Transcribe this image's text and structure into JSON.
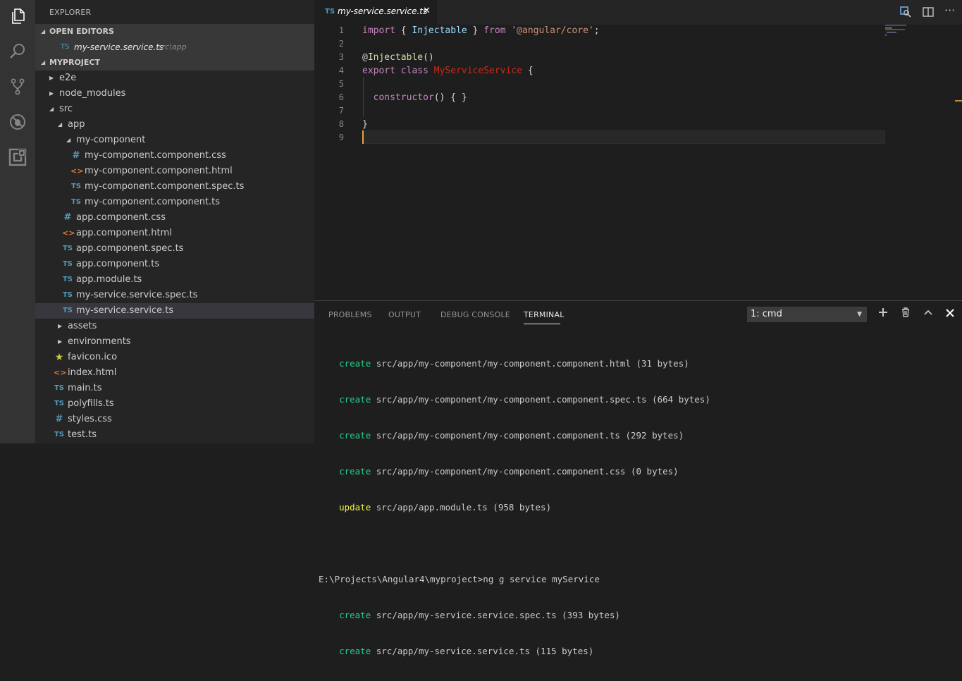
{
  "activity_bar": {
    "icons": [
      "files-icon",
      "search-icon",
      "source-control-icon",
      "debug-icon",
      "extensions-icon"
    ]
  },
  "sidebar": {
    "title": "EXPLORER",
    "open_editors": {
      "label": "OPEN EDITORS",
      "items": [
        {
          "icon": "TS",
          "name": "my-service.service.ts",
          "path": "src\\app"
        }
      ]
    },
    "project": {
      "label": "MYPROJECT",
      "tree": [
        {
          "name": "e2e",
          "type": "folder",
          "expanded": false
        },
        {
          "name": "node_modules",
          "type": "folder",
          "expanded": false
        },
        {
          "name": "src",
          "type": "folder",
          "expanded": true
        },
        {
          "name": "app",
          "type": "folder",
          "expanded": true
        },
        {
          "name": "my-component",
          "type": "folder",
          "expanded": true
        },
        {
          "name": "my-component.component.css",
          "type": "css"
        },
        {
          "name": "my-component.component.html",
          "type": "html"
        },
        {
          "name": "my-component.component.spec.ts",
          "type": "ts"
        },
        {
          "name": "my-component.component.ts",
          "type": "ts"
        },
        {
          "name": "app.component.css",
          "type": "css"
        },
        {
          "name": "app.component.html",
          "type": "html"
        },
        {
          "name": "app.component.spec.ts",
          "type": "ts"
        },
        {
          "name": "app.component.ts",
          "type": "ts"
        },
        {
          "name": "app.module.ts",
          "type": "ts"
        },
        {
          "name": "my-service.service.spec.ts",
          "type": "ts"
        },
        {
          "name": "my-service.service.ts",
          "type": "ts",
          "selected": true
        },
        {
          "name": "assets",
          "type": "folder",
          "expanded": false
        },
        {
          "name": "environments",
          "type": "folder",
          "expanded": false
        },
        {
          "name": "favicon.ico",
          "type": "ico"
        },
        {
          "name": "index.html",
          "type": "html"
        },
        {
          "name": "main.ts",
          "type": "ts"
        },
        {
          "name": "polyfills.ts",
          "type": "ts"
        },
        {
          "name": "styles.css",
          "type": "css"
        },
        {
          "name": "test.ts",
          "type": "ts"
        }
      ]
    }
  },
  "editor": {
    "tab": {
      "icon": "TS",
      "name": "my-service.service.ts",
      "close": "✕"
    },
    "line_numbers": [
      "1",
      "2",
      "3",
      "4",
      "5",
      "6",
      "7",
      "8",
      "9"
    ],
    "code": {
      "l1_import": "import",
      "l1_open": " { ",
      "l1_ident": "Injectable",
      "l1_close": " } ",
      "l1_from": "from",
      "l1_sp": " ",
      "l1_str": "'@angular/core'",
      "l1_semi": ";",
      "l3_at": "@",
      "l3_deco": "Injectable",
      "l3_parens": "()",
      "l4_export": "export",
      "l4_class": "class",
      "l4_name": "MyServiceService",
      "l4_brace": " {",
      "l6_ctor": "constructor",
      "l6_rest": "() { }",
      "l8_close": "}"
    }
  },
  "panel": {
    "tabs": [
      "PROBLEMS",
      "OUTPUT",
      "DEBUG CONSOLE",
      "TERMINAL"
    ],
    "active_tab": "TERMINAL",
    "terminal_select": "1: cmd",
    "terminal_lines": [
      {
        "kind": "create",
        "tag": "create",
        "text": " src/app/my-component/my-component.component.html (31 bytes)"
      },
      {
        "kind": "create",
        "tag": "create",
        "text": " src/app/my-component/my-component.component.spec.ts (664 bytes)"
      },
      {
        "kind": "create",
        "tag": "create",
        "text": " src/app/my-component/my-component.component.ts (292 bytes)"
      },
      {
        "kind": "create",
        "tag": "create",
        "text": " src/app/my-component/my-component.component.css (0 bytes)"
      },
      {
        "kind": "update",
        "tag": "update",
        "text": " src/app/app.module.ts (958 bytes)"
      },
      {
        "kind": "blank",
        "tag": "",
        "text": ""
      },
      {
        "kind": "prompt",
        "tag": "",
        "text": "E:\\Projects\\Angular4\\myproject>ng g service myService"
      },
      {
        "kind": "create",
        "tag": "create",
        "text": " src/app/my-service.service.spec.ts (393 bytes)"
      },
      {
        "kind": "create",
        "tag": "create",
        "text": " src/app/my-service.service.ts (115 bytes)"
      }
    ]
  }
}
